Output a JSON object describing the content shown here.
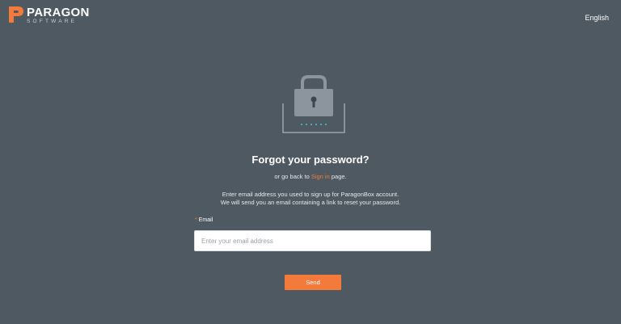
{
  "brand": {
    "name": "PARAGON",
    "subtitle": "SOFTWARE",
    "accent_color": "#f47a3b"
  },
  "header": {
    "language": "English"
  },
  "illustration": {
    "icon": "padlock-icon",
    "dots": "••••••"
  },
  "form": {
    "title": "Forgot your password?",
    "back_prefix": "or go back to ",
    "back_link": "Sign in",
    "back_suffix": " page.",
    "instructions_line1": "Enter email address you used to sign up for ParagonBox account.",
    "instructions_line2": "We will send you an email containing a link to reset your password.",
    "email_required_mark": "*",
    "email_label": "Email",
    "email_placeholder": "Enter your email address",
    "email_value": "",
    "send_label": "Send"
  },
  "colors": {
    "background": "#4f5962",
    "button": "#f47a3b"
  }
}
